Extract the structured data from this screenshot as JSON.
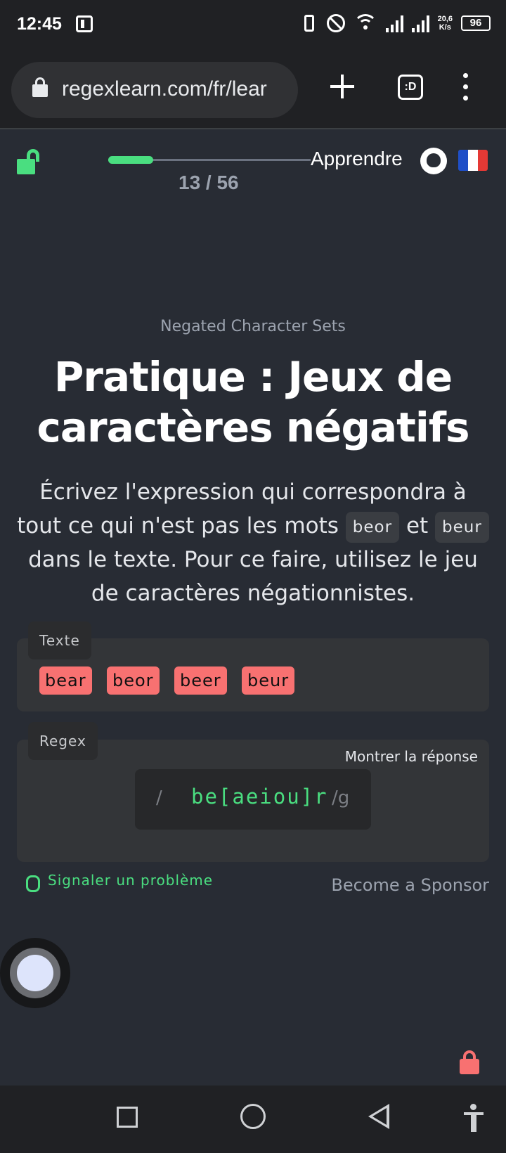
{
  "status_bar": {
    "time": "12:45",
    "network_speed": "20,6",
    "network_unit": "K/s",
    "battery": "96"
  },
  "browser": {
    "url": "regexlearn.com/fr/lear",
    "tabs_label": ":D"
  },
  "header": {
    "progress_text": "13 / 56",
    "progress_fraction": 0.2232,
    "learn_label": "Apprendre"
  },
  "lesson": {
    "subtitle": "Negated Character Sets",
    "title": "Pratique : Jeux de caractères négatifs",
    "desc_part1": "Écrivez l'expression qui correspondra à tout ce qui n'est pas les mots",
    "code1": "beor",
    "desc_and": "et",
    "code2": "beur",
    "desc_part2": "dans le texte. Pour ce faire, utilisez le jeu de caractères négationnistes."
  },
  "text_card": {
    "tag": "Texte",
    "words": [
      "bear",
      "beor",
      "beer",
      "beur"
    ],
    "match_color": "#f87171"
  },
  "regex_card": {
    "tag": "Regex",
    "show_answer": "Montrer la réponse",
    "open_slash": "/",
    "value": "be[aeiou]r",
    "flags": "/g"
  },
  "footer_links": {
    "report": "Signaler un problème",
    "sponsor": "Become a Sponsor"
  },
  "colors": {
    "accent": "#4ade80",
    "error": "#f87171",
    "background": "#282c34"
  }
}
